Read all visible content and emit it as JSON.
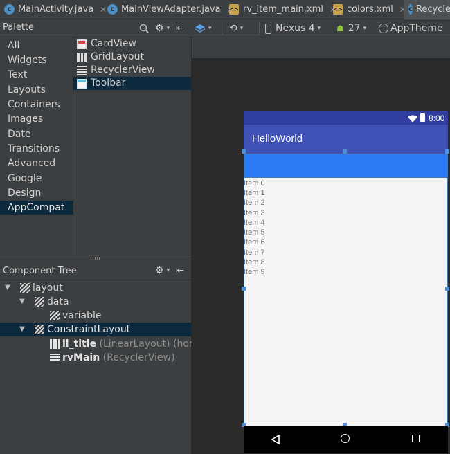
{
  "tabs": [
    {
      "label": "MainActivity.java",
      "icon": "C"
    },
    {
      "label": "MainViewAdapter.java",
      "icon": "C"
    },
    {
      "label": "rv_item_main.xml",
      "icon": "xml"
    },
    {
      "label": "colors.xml",
      "icon": "xml"
    },
    {
      "label": "Recycle",
      "icon": "C"
    }
  ],
  "palette": {
    "title": "Palette",
    "categories": [
      "All",
      "Widgets",
      "Text",
      "Layouts",
      "Containers",
      "Images",
      "Date",
      "Transitions",
      "Advanced",
      "Google",
      "Design",
      "AppCompat"
    ],
    "selected_category": "AppCompat",
    "widgets": [
      "CardView",
      "GridLayout",
      "RecyclerView",
      "Toolbar"
    ],
    "selected_widget": "Toolbar"
  },
  "toolbar": {
    "device": "Nexus 4",
    "api": "27",
    "theme": "AppTheme"
  },
  "component_tree": {
    "title": "Component Tree",
    "nodes": [
      {
        "label": "layout",
        "suffix": ""
      },
      {
        "label": "data",
        "suffix": ""
      },
      {
        "label": "variable",
        "suffix": ""
      },
      {
        "label": "ConstraintLayout",
        "suffix": ""
      },
      {
        "label": "ll_title",
        "suffix": "(LinearLayout) (horiz"
      },
      {
        "label": "rvMain",
        "suffix": "(RecyclerView)"
      }
    ]
  },
  "preview": {
    "time": "8:00",
    "app_title": "HelloWorld",
    "items": [
      "Item 0",
      "Item 1",
      "Item 2",
      "Item 3",
      "Item 4",
      "Item 5",
      "Item 6",
      "Item 7",
      "Item 8",
      "Item 9"
    ]
  },
  "colors": {
    "status_bar": "#303f9f",
    "app_bar": "#3f51b5",
    "toolbar_view": "#2d7cf6",
    "selection": "#0d293e"
  }
}
